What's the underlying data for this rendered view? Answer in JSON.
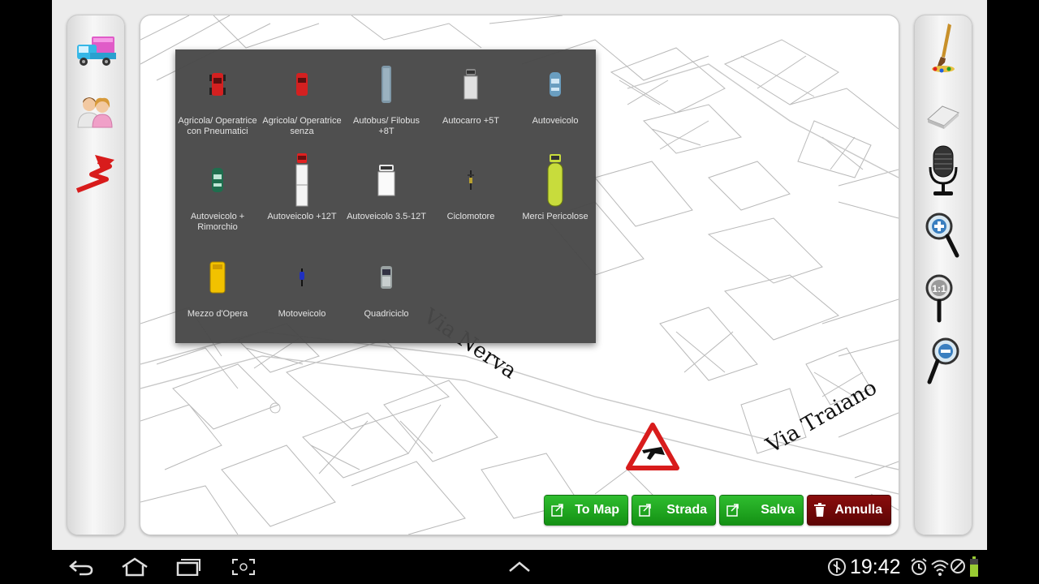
{
  "map": {
    "streets": [
      "Via Nerva",
      "Via Traiano"
    ]
  },
  "vehicle_menu": {
    "items": [
      {
        "label": "Agricola/ Operatrice con Pneumatici",
        "icon": "red-tractor-icon",
        "color": "#d42020"
      },
      {
        "label": "Agricola/ Operatrice senza",
        "icon": "red-tractor-icon",
        "color": "#d42020"
      },
      {
        "label": "Autobus/ Filobus +8T",
        "icon": "bus-icon",
        "color": "#7f98a8"
      },
      {
        "label": "Autocarro +5T",
        "icon": "truck-icon",
        "color": "#d8d8d8"
      },
      {
        "label": "Autoveicolo",
        "icon": "car-icon",
        "color": "#6a9ec0"
      },
      {
        "label": "Autoveicolo + Rimorchio",
        "icon": "car-trailer-icon",
        "color": "#1f6e4e"
      },
      {
        "label": "Autoveicolo +12T",
        "icon": "heavy-truck-icon",
        "color": "#e02020"
      },
      {
        "label": "Autoveicolo 3.5-12T",
        "icon": "van-icon",
        "color": "#f2f2f2"
      },
      {
        "label": "Ciclomotore",
        "icon": "moped-icon",
        "color": "#222222"
      },
      {
        "label": "Merci Pericolose",
        "icon": "tanker-icon",
        "color": "#c8dc3c"
      },
      {
        "label": "Mezzo d'Opera",
        "icon": "work-vehicle-icon",
        "color": "#f2c200"
      },
      {
        "label": "Motoveicolo",
        "icon": "motorcycle-icon",
        "color": "#2030c0"
      },
      {
        "label": "Quadriciclo",
        "icon": "quadricycle-icon",
        "color": "#9aa2a2"
      }
    ]
  },
  "actions": {
    "to_map": "To Map",
    "strada": "Strada",
    "salva": "Salva",
    "annulla": "Annulla"
  },
  "left_tools": [
    "vehicles-icon",
    "people-icon",
    "road-arrow-icon"
  ],
  "right_tools": [
    "paintbrush-icon",
    "eraser-icon",
    "microphone-icon",
    "zoom-in-icon",
    "zoom-reset-icon",
    "zoom-out-icon"
  ],
  "zoom_reset_label": "1:1",
  "status_bar": {
    "time": "19:42"
  },
  "colors": {
    "action_green": "#1ea81e",
    "action_red": "#7a0a0a",
    "popup_bg": "#484848"
  }
}
